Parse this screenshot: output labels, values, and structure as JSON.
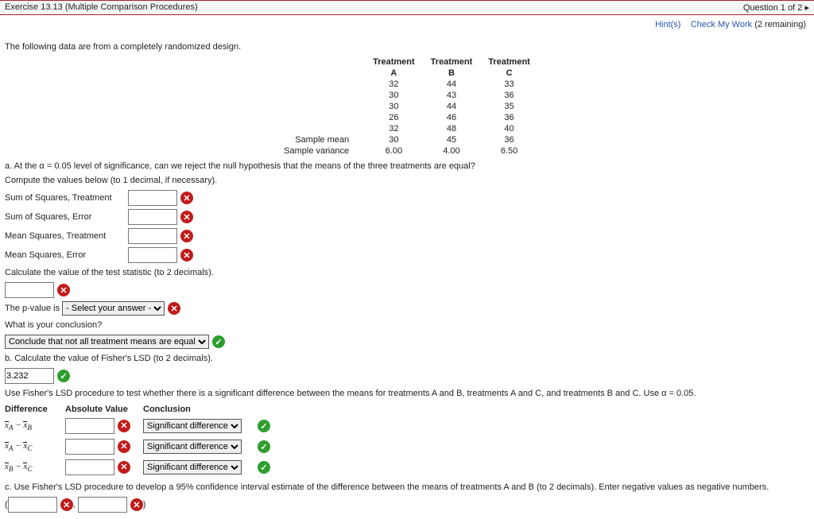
{
  "header": {
    "title": "Exercise 13.13 (Multiple Comparison Procedures)",
    "question": "Question 1 of 2 ▸",
    "hints": "Hint(s)",
    "check": "Check My Work",
    "remaining": "(2 remaining)"
  },
  "intro": "The following data are from a completely randomized design.",
  "tbl": {
    "ha": "Treatment",
    "hb": "Treatment",
    "hc": "Treatment",
    "A": "A",
    "B": "B",
    "C": "C",
    "rows": [
      {
        "a": "32",
        "b": "44",
        "c": "33"
      },
      {
        "a": "30",
        "b": "43",
        "c": "36"
      },
      {
        "a": "30",
        "b": "44",
        "c": "35"
      },
      {
        "a": "26",
        "b": "46",
        "c": "36"
      },
      {
        "a": "32",
        "b": "48",
        "c": "40"
      }
    ],
    "meanLab": "Sample mean",
    "meanA": "30",
    "meanB": "45",
    "meanC": "36",
    "varLab": "Sample variance",
    "varA": "6.00",
    "varB": "4.00",
    "varC": "6.50"
  },
  "qa": "a. At the α = 0.05 level of significance, can we reject the null hypothesis that the means of the three treatments are equal?",
  "compute": "Compute the values below (to 1 decimal, if necessary).",
  "labs": {
    "ssT": "Sum of Squares, Treatment",
    "ssE": "Sum of Squares, Error",
    "msT": "Mean Squares, Treatment",
    "msE": "Mean Squares, Error"
  },
  "calcF": "Calculate the value of the test statistic (to 2 decimals).",
  "pvalPre": "The p-value is",
  "pvalSel": "- Select your answer -",
  "concQ": "What is your conclusion?",
  "concSel": "Conclude that not all treatment means are equal",
  "qb": "b. Calculate the value of Fisher's LSD (to 2 decimals).",
  "lsdVal": "3.232",
  "useLSD": "Use Fisher's LSD procedure to test whether there is a significant difference between the means for treatments A and B, treatments A and C, and treatments B and C. Use α = 0.05.",
  "tblC": {
    "h1": "Difference",
    "h2": "Absolute Value",
    "h3": "Conclusion",
    "sig": "Significant difference"
  },
  "qc": "c. Use Fisher's LSD procedure to develop a 95% confidence interval estimate of the difference between the means of treatments A and B (to 2 decimals). Enter negative values as negative numbers.",
  "paren": {
    "l": "(",
    "comma": ",",
    "r": ")"
  }
}
